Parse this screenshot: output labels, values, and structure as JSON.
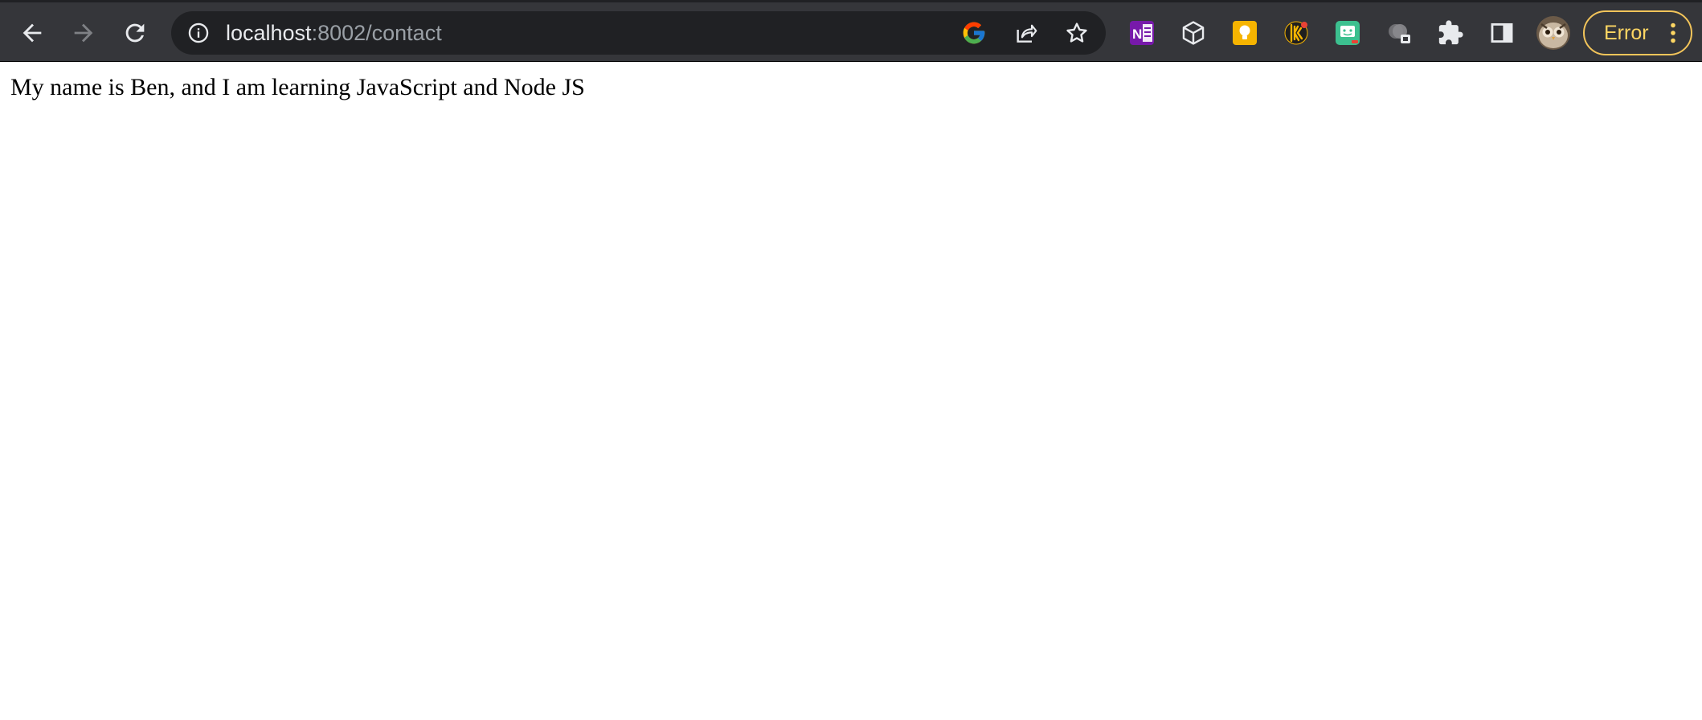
{
  "browser": {
    "address_bar": {
      "host": "localhost",
      "path": ":8002/contact"
    },
    "error_button_label": "Error",
    "accent_color": "#fdd663",
    "icons": {
      "back": "back-arrow-icon",
      "forward": "forward-arrow-icon",
      "reload": "reload-icon",
      "site_info": "info-icon",
      "google_lens": "google-icon",
      "share": "share-icon",
      "bookmark": "star-icon",
      "extensions": [
        "onenote-icon",
        "cube-icon",
        "lightbulb-icon",
        "keeper-icon",
        "grammar-icon",
        "screen-recorder-icon",
        "puzzle-icon"
      ],
      "side_panel": "side-panel-icon",
      "profile": "owl-avatar-icon",
      "menu": "three-dots-icon"
    }
  },
  "page": {
    "body_text": "My name is Ben, and I am learning JavaScript and Node JS"
  }
}
